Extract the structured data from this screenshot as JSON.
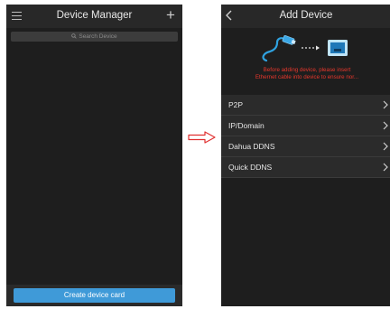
{
  "device_manager": {
    "title": "Device Manager",
    "search_placeholder": "Search Device",
    "create_button": "Create device card"
  },
  "add_device": {
    "title": "Add Device",
    "warning_line1": "Before adding device, please insert",
    "warning_line2": "Ethernet cable into device to ensure nor...",
    "options": [
      {
        "label": "P2P"
      },
      {
        "label": "IP/Domain"
      },
      {
        "label": "Dahua DDNS"
      },
      {
        "label": "Quick DDNS"
      }
    ]
  },
  "colors": {
    "accent_blue": "#3f9ad8",
    "warning_red": "#e8372c",
    "arrow_red": "#e03030"
  }
}
